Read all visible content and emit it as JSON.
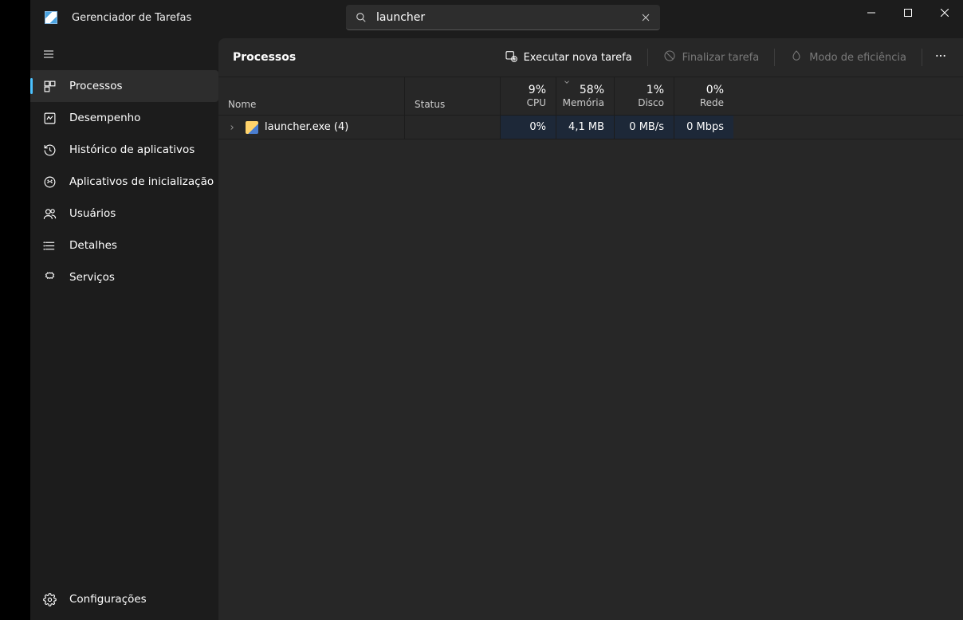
{
  "app_title": "Gerenciador de Tarefas",
  "search": {
    "value": "launcher"
  },
  "sidebar": {
    "items": [
      {
        "label": "Processos"
      },
      {
        "label": "Desempenho"
      },
      {
        "label": "Histórico de aplicativos"
      },
      {
        "label": "Aplicativos de inicialização"
      },
      {
        "label": "Usuários"
      },
      {
        "label": "Detalhes"
      },
      {
        "label": "Serviços"
      }
    ],
    "settings_label": "Configurações"
  },
  "main": {
    "title": "Processos",
    "toolbar": {
      "new_task": "Executar nova tarefa",
      "end_task": "Finalizar tarefa",
      "efficiency": "Modo de eficiência"
    },
    "columns": {
      "name": "Nome",
      "status": "Status",
      "cpu": {
        "value": "9%",
        "label": "CPU"
      },
      "memory": {
        "value": "58%",
        "label": "Memória"
      },
      "disk": {
        "value": "1%",
        "label": "Disco"
      },
      "network": {
        "value": "0%",
        "label": "Rede"
      }
    },
    "rows": [
      {
        "name": "launcher.exe (4)",
        "cpu": "0%",
        "memory": "4,1 MB",
        "disk": "0 MB/s",
        "network": "0 Mbps"
      }
    ]
  }
}
